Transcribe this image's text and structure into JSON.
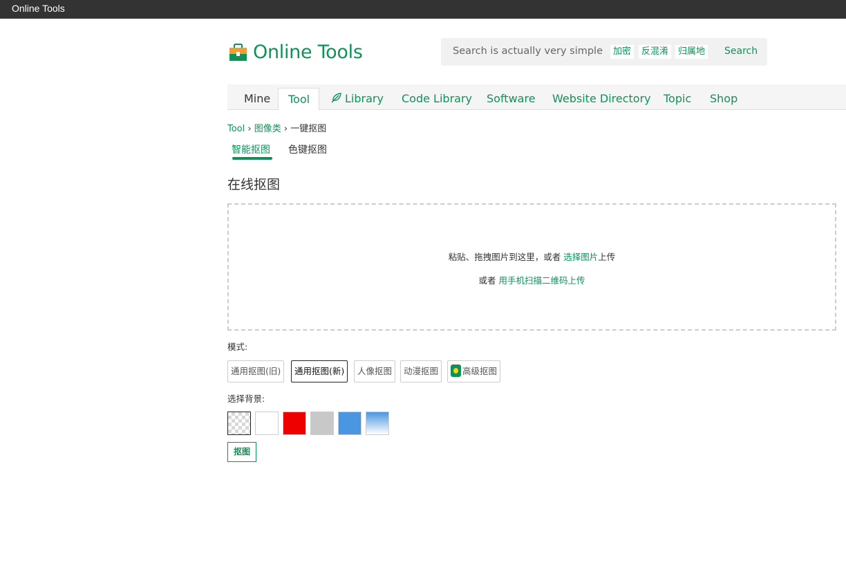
{
  "window": {
    "title": "Online Tools"
  },
  "header": {
    "logo_text": "Online Tools",
    "search": {
      "placeholder": "Search is actually very simple",
      "tags": [
        "加密",
        "反混淆",
        "归属地"
      ],
      "button": "Search"
    }
  },
  "nav": {
    "items": [
      "Mine",
      "Tool",
      "Library",
      "Code Library",
      "Software",
      "Website Directory",
      "Topic",
      "Shop"
    ],
    "active": "Tool"
  },
  "breadcrumb": {
    "items": [
      "Tool",
      "图像类",
      "一键抠图"
    ]
  },
  "subtabs": {
    "items": [
      "智能抠图",
      "色键抠图"
    ],
    "active": "智能抠图"
  },
  "page": {
    "title": "在线抠图"
  },
  "dropzone": {
    "line1_prefix": "粘贴、拖拽图片到这里，或者 ",
    "line1_link": "选择图片",
    "line1_suffix": "上传",
    "line2_prefix": "或者 ",
    "line2_link": "用手机扫描二维码上传"
  },
  "mode": {
    "label": "模式:",
    "options": [
      "通用抠图(旧)",
      "通用抠图(新)",
      "人像抠图",
      "动漫抠图",
      "高级抠图"
    ],
    "selected": "通用抠图(新)"
  },
  "background": {
    "label": "选择背景:",
    "swatches": [
      "transparent",
      "#ffffff",
      "#ee0000",
      "#c8c8c8",
      "#4a96e0",
      "gradient-blue-white"
    ],
    "selected": "transparent"
  },
  "actions": {
    "cutout_button": "抠图"
  },
  "colors": {
    "accent": "#0d9358",
    "titlebar": "#333333"
  }
}
